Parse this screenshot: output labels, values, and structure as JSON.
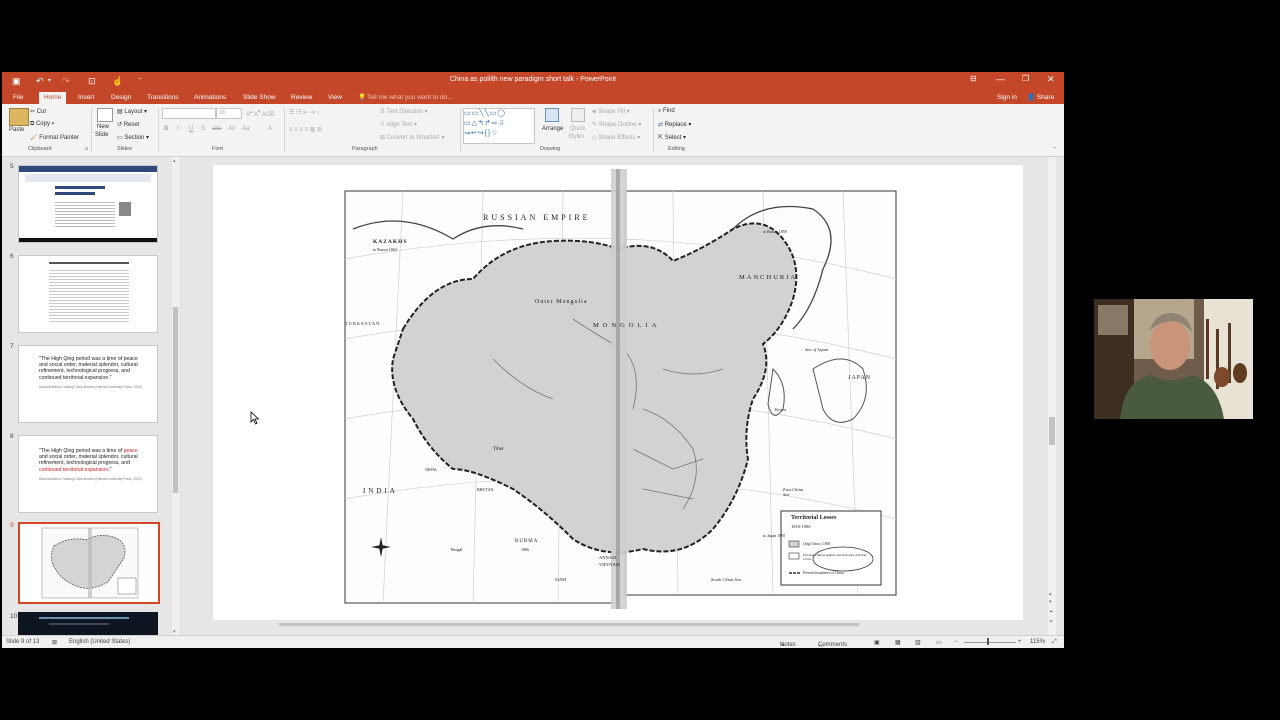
{
  "window": {
    "title": "China as polilth new paradigm short talk - PowerPoint",
    "sign_in": "Sign in",
    "share": "Share"
  },
  "tabs": [
    "File",
    "Home",
    "Insert",
    "Design",
    "Transitions",
    "Animations",
    "Slide Show",
    "Review",
    "View"
  ],
  "tell_me": "Tell me what you want to do...",
  "ribbon": {
    "clipboard": {
      "paste": "Paste",
      "cut": "Cut",
      "copy": "Copy",
      "format_painter": "Format Painter",
      "label": "Clipboard"
    },
    "slides": {
      "new_slide_1": "New",
      "new_slide_2": "Slide",
      "layout": "Layout",
      "reset": "Reset",
      "section": "Section",
      "label": "Slides"
    },
    "font": {
      "label": "Font",
      "size": "18"
    },
    "paragraph": {
      "text_direction": "Text Direction",
      "align_text": "Align Text",
      "convert_smartart": "Convert to SmartArt",
      "label": "Paragraph"
    },
    "drawing": {
      "arrange": "Arrange",
      "quick_styles_1": "Quick",
      "quick_styles_2": "Styles",
      "shape_fill": "Shape Fill",
      "shape_outline": "Shape Outline",
      "shape_effects": "Shape Effects",
      "label": "Drawing"
    },
    "editing": {
      "find": "Find",
      "replace": "Replace",
      "select": "Select",
      "label": "Editing"
    }
  },
  "thumbnails": {
    "numbers": [
      "5",
      "6",
      "7",
      "8",
      "9",
      "10"
    ],
    "slide7": {
      "quote": "\"The High Qing period was a time of peace and social order, material splendor, cultural refinement, technological progress, and continued territorial expansion.\"",
      "cite": "Dana McMahon, Making China Modern (Harvard University Press, 2019)"
    },
    "slide8": {
      "q1": "\"The High Qing period was a time of ",
      "q_peace": "peace",
      "q2": " and social order, material splendor, cultural refinement, technological progress, and ",
      "q_cont": "continued territorial expansion",
      "q3": ".\"",
      "cite": "Dana McMahon, Making China Modern (Harvard University Press, 2019)"
    }
  },
  "map": {
    "labels": {
      "russian_empire": "RUSSIAN EMPIRE",
      "kazakhs": "KAZAKHS",
      "to_russia_1864": "to Russia 1864",
      "outer_mongolia": "Outer Mongolia",
      "mongolia": "MONGOLIA",
      "manchuria": "MANCHURIA",
      "to_russia_1858": "to Russia 1858",
      "sea_of_japan": "Sea of Japan",
      "japan": "JAPAN",
      "turkestan": "TURKESTAN",
      "tibet": "Tibet",
      "india": "INDIA",
      "nepal": "NEPAL",
      "bhutan": "BHUTAN",
      "burma": "BURMA",
      "burma_date": "1886",
      "annam": "ANNAM",
      "vietnam": "VIETNAM",
      "siam": "SIAM",
      "korea": "Korea",
      "taiwan": "to Japan 1895",
      "east_china_sea": "East China Sea",
      "south_china_sea": "South China Sea",
      "bengal": "Bengal"
    },
    "legend": {
      "title": "Territorial Losses",
      "years": "1810-1900",
      "item1": "Qing China c.1800",
      "item2": "Previous Chinese spheres and territories with date of loss",
      "item3": "Present boundaries of China"
    }
  },
  "status": {
    "slide": "Slide 9 of 13",
    "language": "English (United States)",
    "notes": "Notes",
    "comments": "Comments",
    "zoom": "115%"
  }
}
